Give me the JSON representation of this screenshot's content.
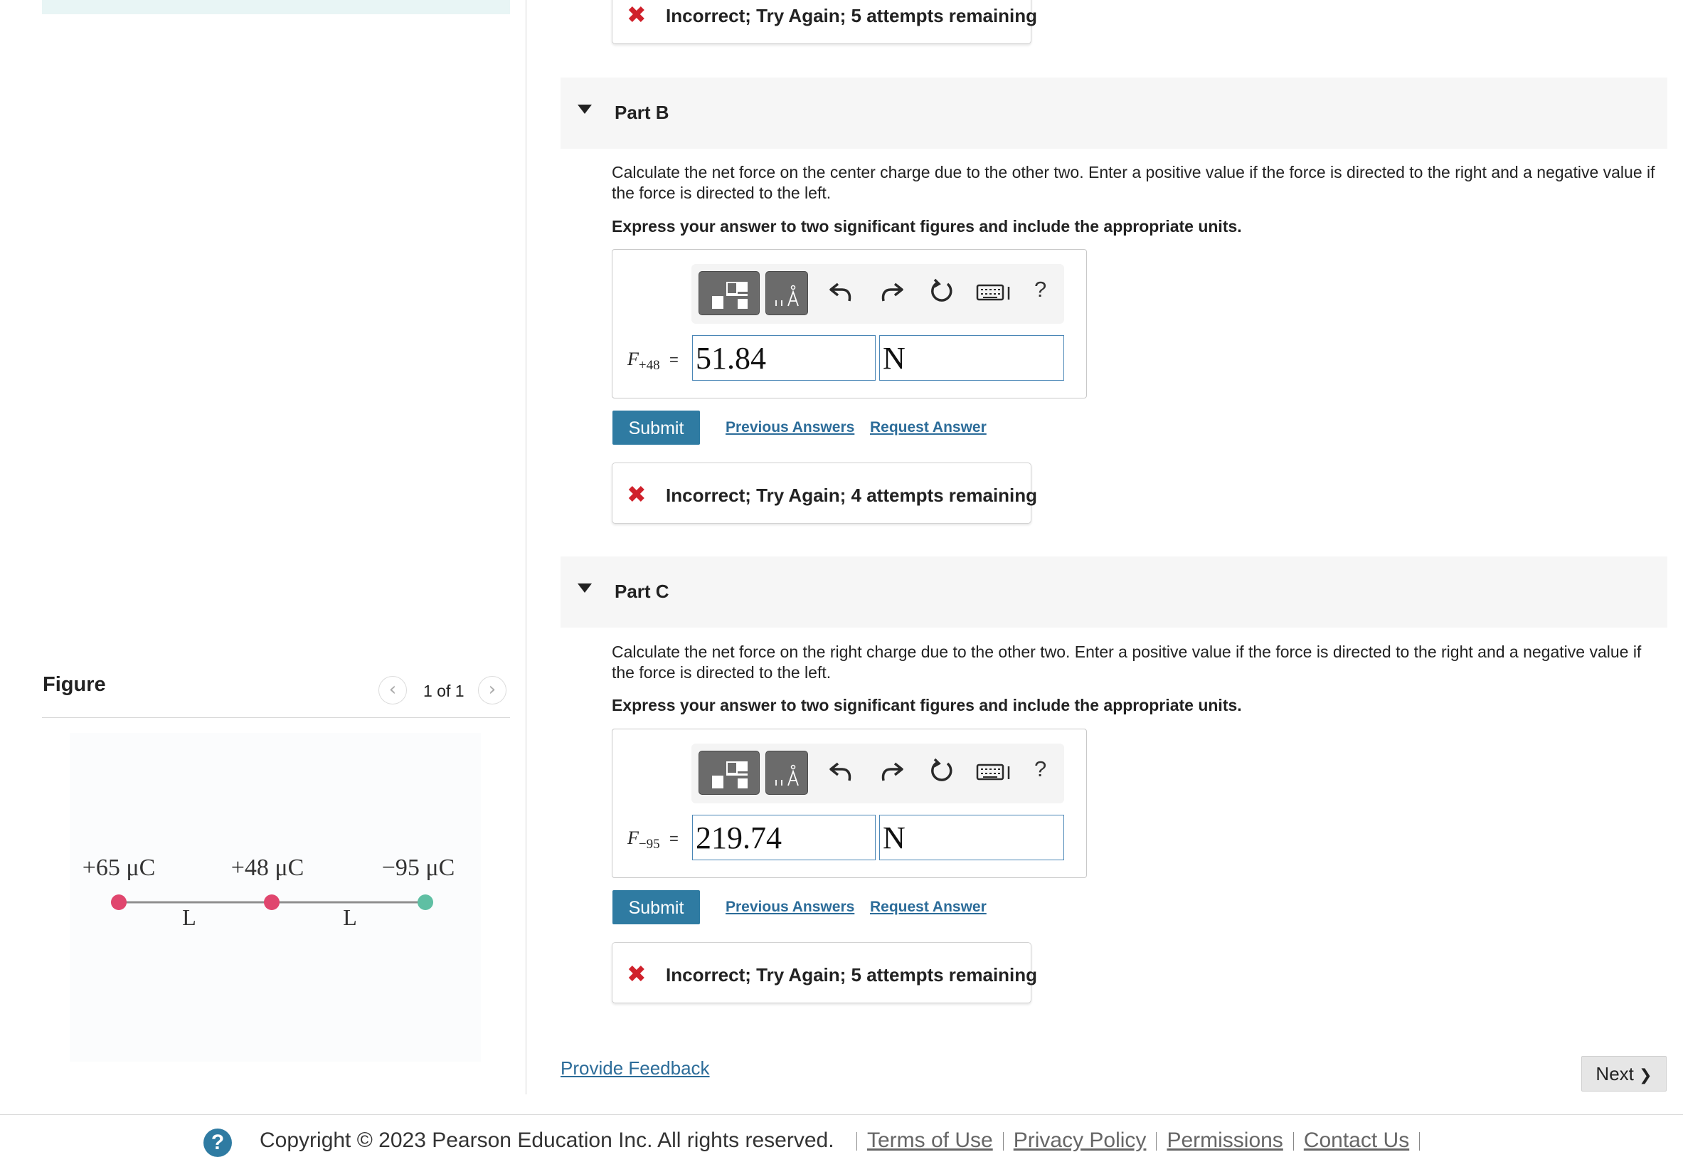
{
  "part_a": {
    "feedback": "Incorrect; Try Again; 5 attempts remaining"
  },
  "part_b": {
    "title": "Part B",
    "question": "Calculate the net force on the center charge due to the other two. Enter a positive value if the force is directed to the right and a negative value if the force is directed to the left.",
    "instruction": "Express your answer to two significant figures and include the appropriate units.",
    "variable_symbol": "F",
    "variable_subscript": "+48",
    "equals": "=",
    "value": "51.84",
    "unit": "N",
    "submit_label": "Submit",
    "previous_answers_label": "Previous Answers",
    "request_answer_label": "Request Answer",
    "feedback": "Incorrect; Try Again; 4 attempts remaining"
  },
  "part_c": {
    "title": "Part C",
    "question": "Calculate the net force on the right charge due to the other two. Enter a positive value if the force is directed to the right and a negative value if the force is directed to the left.",
    "instruction": "Express your answer to two significant figures and include the appropriate units.",
    "variable_symbol": "F",
    "variable_subscript": "−95",
    "equals": "=",
    "value": "219.74",
    "unit": "N",
    "submit_label": "Submit",
    "previous_answers_label": "Previous Answers",
    "request_answer_label": "Request Answer",
    "feedback": "Incorrect; Try Again; 5 attempts remaining"
  },
  "toolbar": {
    "icons": [
      "templates-icon",
      "units-icon",
      "undo-icon",
      "redo-icon",
      "reset-icon",
      "keyboard-icon",
      "help-icon"
    ],
    "help_label": "?"
  },
  "figure": {
    "title": "Figure",
    "counter": "1 of 1",
    "prev_glyph": "‹",
    "next_glyph": "›",
    "charges": [
      {
        "label": "+65 μC",
        "color": "#e0466e"
      },
      {
        "label": "+48 μC",
        "color": "#e0466e"
      },
      {
        "label": "−95 μC",
        "color": "#5fbfa3"
      }
    ],
    "spacing_labels": [
      "L",
      "L"
    ]
  },
  "provide_feedback_label": "Provide Feedback",
  "next_label": "Next",
  "next_glyph": "❯",
  "footer": {
    "help_glyph": "?",
    "copyright": "Copyright © 2023 Pearson Education Inc. All rights reserved.",
    "links": [
      "Terms of Use",
      "Privacy Policy",
      "Permissions",
      "Contact Us"
    ]
  },
  "colors": {
    "link": "#2c6c99",
    "submit": "#2f7ba2",
    "error": "#d0212b",
    "input_border": "#4a86b6"
  }
}
